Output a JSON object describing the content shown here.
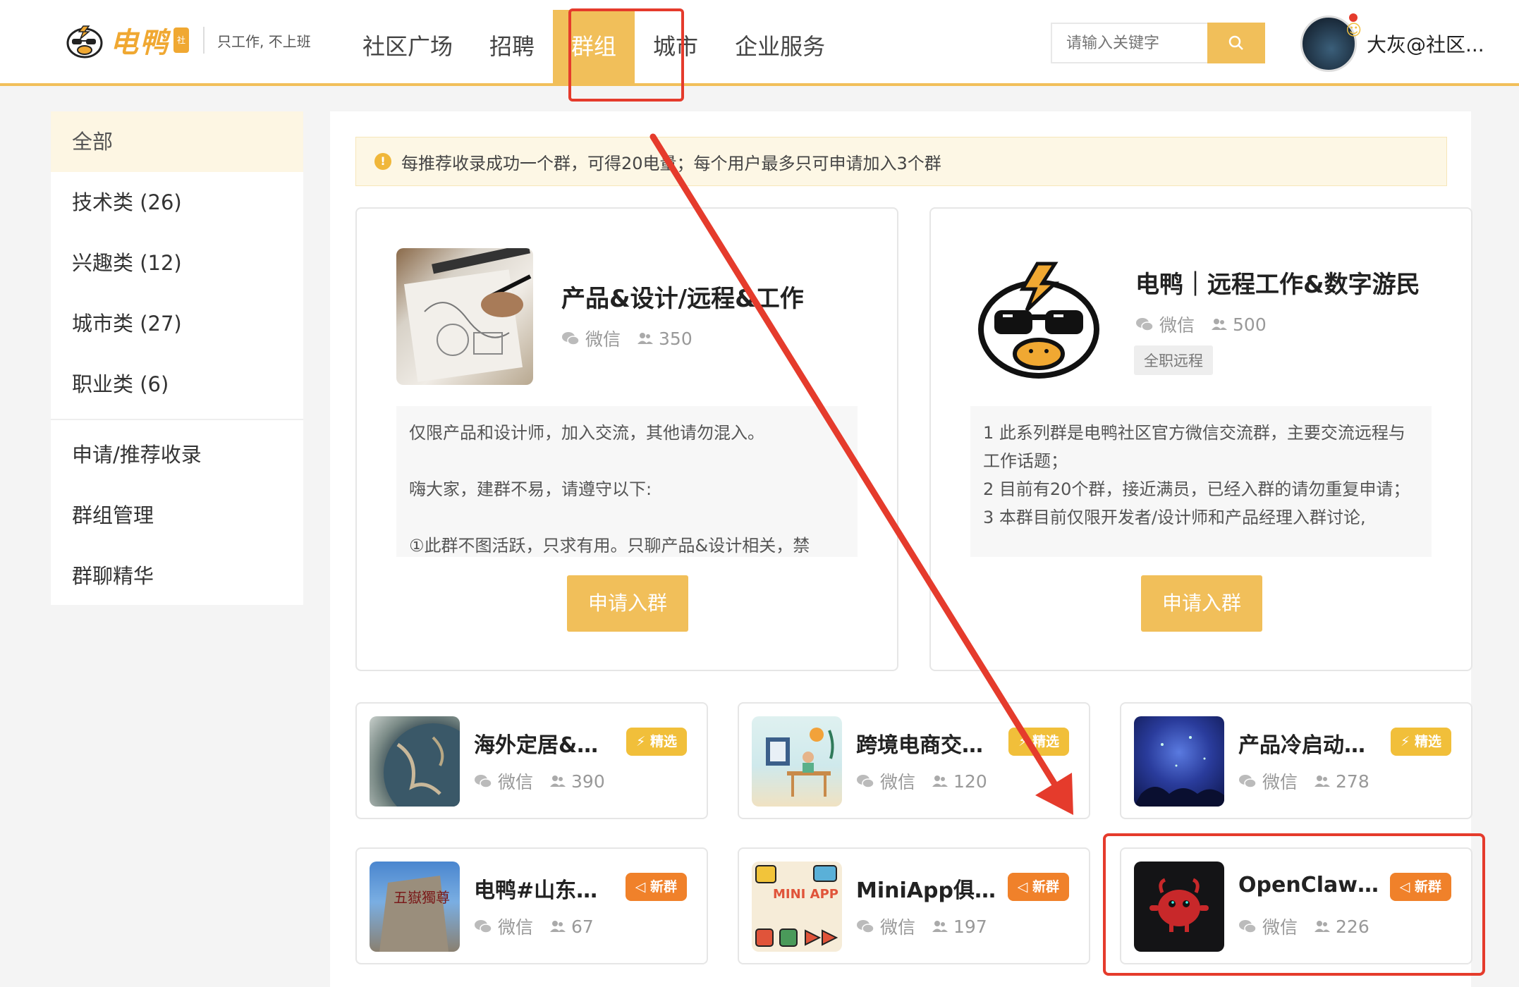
{
  "header": {
    "logo_text": "电鸭",
    "logo_badge": "社区",
    "slogan": "只工作, 不上班",
    "nav": [
      "社区广场",
      "招聘",
      "群组",
      "城市",
      "企业服务"
    ],
    "active_nav": "群组",
    "search_placeholder": "请输入关键字",
    "user_name": "大灰@社区..."
  },
  "sidebar": {
    "items": [
      "全部",
      "技术类 (26)",
      "兴趣类 (12)",
      "城市类 (27)",
      "职业类 (6)"
    ],
    "links": [
      "申请/推荐收录",
      "群组管理",
      "群聊精华"
    ]
  },
  "notice": "每推荐收录成功一个群，可得20电量；每个用户最多只可申请加入3个群",
  "featured": [
    {
      "title": "产品&设计/远程&工作",
      "platform": "微信",
      "members": "350",
      "desc": "仅限产品和设计师，加入交流，其他请勿混入。\n\n嗨大家，建群不易，请遵守以下:\n\n①此群不图活跃，只求有用。只聊产品&设计相关，禁",
      "button": "申请入群"
    },
    {
      "title": "电鸭｜远程工作&数字游民",
      "platform": "微信",
      "members": "500",
      "tag": "全职远程",
      "desc": "1 此系列群是电鸭社区官方微信交流群，主要交流远程与工作话题；\n2 目前有20个群，接近满员，已经入群的请勿重复申请；\n3 本群目前仅限开发者/设计师和产品经理入群讨论,",
      "button": "申请入群"
    }
  ],
  "groups": [
    {
      "title": "海外定居&旅...",
      "platform": "微信",
      "members": "390",
      "badge": "精选",
      "badge_type": "feat"
    },
    {
      "title": "跨境电商交流群",
      "platform": "微信",
      "members": "120",
      "badge": "精选",
      "badge_type": "feat"
    },
    {
      "title": "产品冷启动互...",
      "platform": "微信",
      "members": "278",
      "badge": "精选",
      "badge_type": "feat"
    },
    {
      "title": "电鸭#山东分舵",
      "platform": "微信",
      "members": "67",
      "badge": "新群",
      "badge_type": "new"
    },
    {
      "title": "MiniApp俱乐部",
      "platform": "微信",
      "members": "197",
      "badge": "新群",
      "badge_type": "new"
    },
    {
      "title": "OpenClaw🦞",
      "platform": "微信",
      "members": "226",
      "badge": "新群",
      "badge_type": "new"
    }
  ],
  "thumb_texts": {
    "stone": "五嶽獨尊",
    "miniapp": "MINI APP CLUB"
  },
  "colors": {
    "accent": "#f1bf5a",
    "highlight": "#e53b2c",
    "new_badge": "#f0812a"
  }
}
